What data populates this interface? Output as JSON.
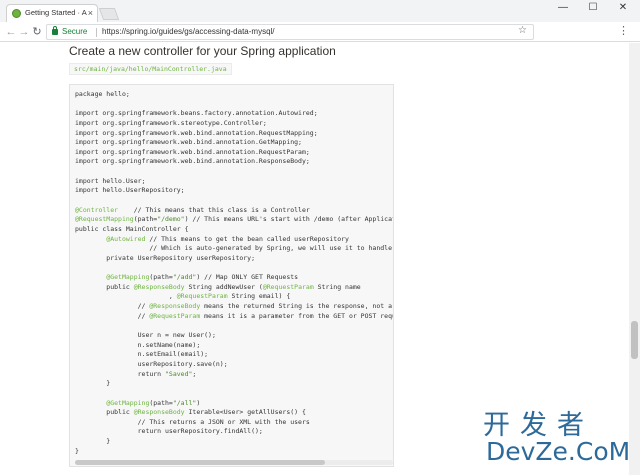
{
  "browser": {
    "tab_title": "Getting Started · Accessing",
    "tab_close": "×",
    "window_controls": {
      "minimize": "—",
      "maximize": "☐",
      "close": "✕"
    },
    "nav": {
      "back": "←",
      "forward": "→",
      "reload": "↻"
    },
    "secure_label": "Secure",
    "url": "https://spring.io/guides/gs/accessing-data-mysql/",
    "bookmark_icon": "star-icon",
    "menu": "⋮"
  },
  "page": {
    "heading": "Create a new controller for your Spring application",
    "file_path": "src/main/java/hello/MainController.java",
    "code_lines": [
      [
        {
          "t": "package hello;"
        }
      ],
      [
        {
          "t": ""
        }
      ],
      [
        {
          "t": "import org.springframework.beans.factory.annotation.Autowired;"
        }
      ],
      [
        {
          "t": "import org.springframework.stereotype.Controller;"
        }
      ],
      [
        {
          "t": "import org.springframework.web.bind.annotation.RequestMapping;"
        }
      ],
      [
        {
          "t": "import org.springframework.web.bind.annotation.GetMapping;"
        }
      ],
      [
        {
          "t": "import org.springframework.web.bind.annotation.RequestParam;"
        }
      ],
      [
        {
          "t": "import org.springframework.web.bind.annotation.ResponseBody;"
        }
      ],
      [
        {
          "t": ""
        }
      ],
      [
        {
          "t": "import hello.User;"
        }
      ],
      [
        {
          "t": "import hello.UserRepository;"
        }
      ],
      [
        {
          "t": ""
        }
      ],
      [
        {
          "t": "@Controller",
          "c": "ann"
        },
        {
          "t": "    // This means that this class is a Controller"
        }
      ],
      [
        {
          "t": "@RequestMapping",
          "c": "ann"
        },
        {
          "t": "(path="
        },
        {
          "t": "\"/demo\"",
          "c": "str"
        },
        {
          "t": ") // This means URL's start with /demo (after Application path)"
        }
      ],
      [
        {
          "t": "public class MainController {"
        }
      ],
      [
        {
          "t": "        "
        },
        {
          "t": "@Autowired",
          "c": "ann"
        },
        {
          "t": " // This means to get the bean called userRepository"
        }
      ],
      [
        {
          "t": "                   // Which is auto-generated by Spring, we will use it to handle the data"
        }
      ],
      [
        {
          "t": "        private UserRepository userRepository;"
        }
      ],
      [
        {
          "t": ""
        }
      ],
      [
        {
          "t": "        "
        },
        {
          "t": "@GetMapping",
          "c": "ann"
        },
        {
          "t": "(path="
        },
        {
          "t": "\"/add\"",
          "c": "str"
        },
        {
          "t": ") // Map ONLY GET Requests"
        }
      ],
      [
        {
          "t": "        public "
        },
        {
          "t": "@ResponseBody",
          "c": "ann"
        },
        {
          "t": " String addNewUser ("
        },
        {
          "t": "@RequestParam",
          "c": "ann"
        },
        {
          "t": " String name"
        }
      ],
      [
        {
          "t": "                        , "
        },
        {
          "t": "@RequestParam",
          "c": "ann"
        },
        {
          "t": " String email) {"
        }
      ],
      [
        {
          "t": "                // "
        },
        {
          "t": "@ResponseBody",
          "c": "ann"
        },
        {
          "t": " means the returned String is the response, not a view name"
        }
      ],
      [
        {
          "t": "                // "
        },
        {
          "t": "@RequestParam",
          "c": "ann"
        },
        {
          "t": " means it is a parameter from the GET or POST request"
        }
      ],
      [
        {
          "t": ""
        }
      ],
      [
        {
          "t": "                User n = new User();"
        }
      ],
      [
        {
          "t": "                n.setName(name);"
        }
      ],
      [
        {
          "t": "                n.setEmail(email);"
        }
      ],
      [
        {
          "t": "                userRepository.save(n);"
        }
      ],
      [
        {
          "t": "                return "
        },
        {
          "t": "\"Saved\"",
          "c": "str"
        },
        {
          "t": ";"
        }
      ],
      [
        {
          "t": "        }"
        }
      ],
      [
        {
          "t": ""
        }
      ],
      [
        {
          "t": "        "
        },
        {
          "t": "@GetMapping",
          "c": "ann"
        },
        {
          "t": "(path="
        },
        {
          "t": "\"/all\"",
          "c": "str"
        },
        {
          "t": ")"
        }
      ],
      [
        {
          "t": "        public "
        },
        {
          "t": "@ResponseBody",
          "c": "ann"
        },
        {
          "t": " Iterable<User> getAllUsers() {"
        }
      ],
      [
        {
          "t": "                // This returns a JSON or XML with the users"
        }
      ],
      [
        {
          "t": "                return userRepository.findAll();"
        }
      ],
      [
        {
          "t": "        }"
        }
      ],
      [
        {
          "t": "}"
        }
      ]
    ]
  },
  "watermark": {
    "chinese": "开发者",
    "english": "DevZe.CoM"
  },
  "colors": {
    "spring_green": "#6db33f",
    "secure_green": "#188038",
    "watermark_blue": "#2d6a9a"
  }
}
